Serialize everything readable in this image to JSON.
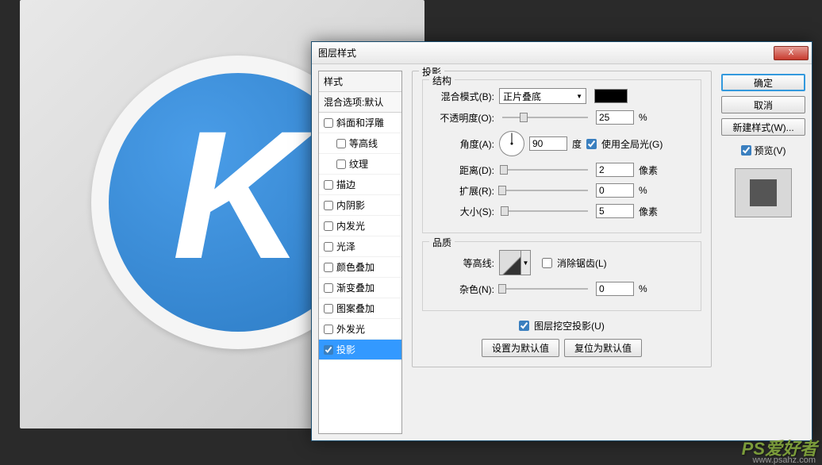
{
  "dialog": {
    "title": "图层样式",
    "close_x": "X"
  },
  "styles_panel": {
    "header": "样式",
    "blending": "混合选项:默认",
    "items": [
      {
        "label": "斜面和浮雕",
        "checked": false
      },
      {
        "label": "等高线",
        "checked": false,
        "indent": true
      },
      {
        "label": "纹理",
        "checked": false,
        "indent": true
      },
      {
        "label": "描边",
        "checked": false
      },
      {
        "label": "内阴影",
        "checked": false
      },
      {
        "label": "内发光",
        "checked": false
      },
      {
        "label": "光泽",
        "checked": false
      },
      {
        "label": "颜色叠加",
        "checked": false
      },
      {
        "label": "渐变叠加",
        "checked": false
      },
      {
        "label": "图案叠加",
        "checked": false
      },
      {
        "label": "外发光",
        "checked": false
      },
      {
        "label": "投影",
        "checked": true,
        "selected": true
      }
    ]
  },
  "shadow": {
    "section_title": "投影",
    "structure_title": "结构",
    "blend_mode_label": "混合模式(B):",
    "blend_mode_value": "正片叠底",
    "opacity_label": "不透明度(O):",
    "opacity_value": "25",
    "opacity_unit": "%",
    "angle_label": "角度(A):",
    "angle_value": "90",
    "angle_unit": "度",
    "global_light_label": "使用全局光(G)",
    "distance_label": "距离(D):",
    "distance_value": "2",
    "distance_unit": "像素",
    "spread_label": "扩展(R):",
    "spread_value": "0",
    "spread_unit": "%",
    "size_label": "大小(S):",
    "size_value": "5",
    "size_unit": "像素",
    "quality_title": "品质",
    "contour_label": "等高线:",
    "antialias_label": "消除锯齿(L)",
    "noise_label": "杂色(N):",
    "noise_value": "0",
    "noise_unit": "%",
    "knockout_label": "图层挖空投影(U)",
    "reset_default": "设置为默认值",
    "restore_default": "复位为默认值"
  },
  "right": {
    "ok": "确定",
    "cancel": "取消",
    "new_style": "新建样式(W)...",
    "preview": "预览(V)"
  },
  "watermark": {
    "brand": "PS爱好者",
    "url": "www.psahz.com"
  }
}
